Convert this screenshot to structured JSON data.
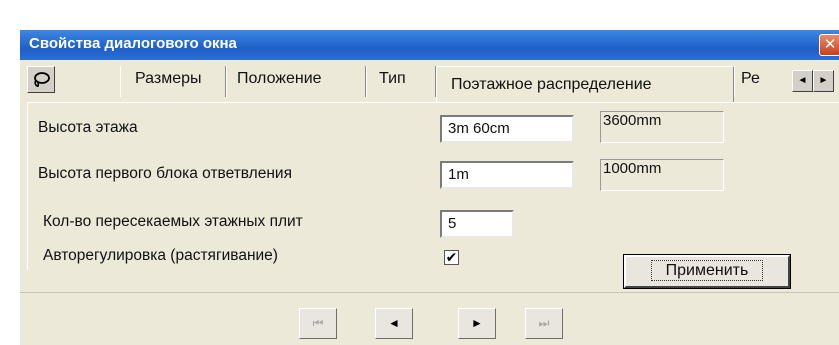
{
  "window": {
    "title": "Свойства диалогового окна",
    "close_glyph": "✕"
  },
  "tabs": [
    {
      "label": "Размеры",
      "active": false
    },
    {
      "label": "Положение",
      "active": false
    },
    {
      "label": "Тип",
      "active": false
    },
    {
      "label": "Поэтажное распределение",
      "active": true
    },
    {
      "label": "Ре",
      "active": false
    }
  ],
  "tab_scroll": {
    "left_glyph": "◄",
    "right_glyph": "►"
  },
  "form": {
    "floor_height": {
      "label": "Высота этажа",
      "value": "3m 60cm",
      "readout": "3600mm"
    },
    "first_block_height": {
      "label": "Высота первого блока ответвления",
      "value": "1m",
      "readout": "1000mm"
    },
    "floor_slabs_count": {
      "label": "Кол-во пересекаемых этажных плит",
      "value": "5"
    },
    "auto_adjust": {
      "label": "Авторегулировка (растягивание)",
      "checked": true,
      "glyph": "✔"
    }
  },
  "apply_button": {
    "label": "Применить"
  },
  "nav": {
    "first": {
      "glyph": "⏮",
      "enabled": false
    },
    "prev": {
      "glyph": "◄",
      "enabled": true
    },
    "next": {
      "glyph": "►",
      "enabled": true
    },
    "last": {
      "glyph": "⏭",
      "enabled": false
    }
  },
  "icons": {
    "dialog_icon": "lasso-icon",
    "accent_title": "#2a6ed3",
    "close_color": "#c6401f"
  }
}
